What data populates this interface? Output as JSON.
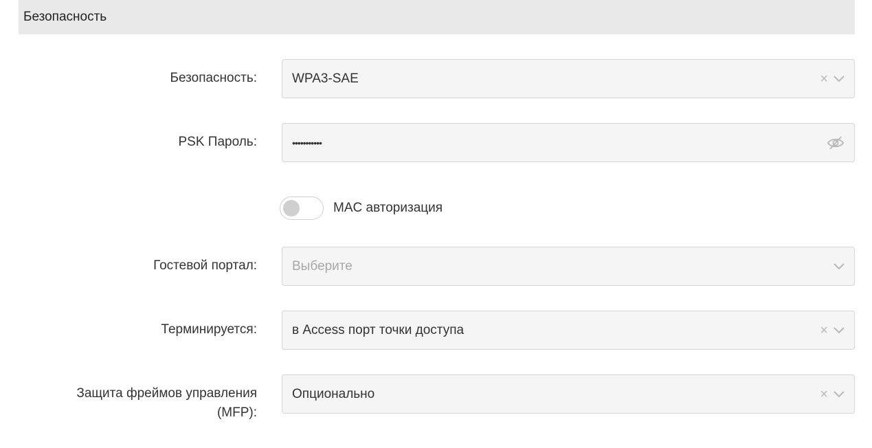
{
  "section": {
    "title": "Безопасность"
  },
  "fields": {
    "security": {
      "label": "Безопасность:",
      "value": "WPA3-SAE"
    },
    "psk_password": {
      "label": "PSK Пароль:",
      "value": "•••••••••••"
    },
    "mac_auth": {
      "label": "MAC авторизация",
      "enabled": false
    },
    "guest_portal": {
      "label": "Гостевой портал:",
      "placeholder": "Выберите"
    },
    "terminated": {
      "label": "Терминируется:",
      "value": "в Access порт точки доступа"
    },
    "mfp": {
      "label_line1": "Защита фреймов управления",
      "label_line2": "(MFP):",
      "value": "Опционально"
    }
  },
  "icons": {
    "clear": "clear-icon",
    "dropdown": "chevron-down-icon",
    "visibility": "eye-off-icon"
  },
  "colors": {
    "header_bg": "#e9e9e9",
    "field_bg": "#f5f5f5",
    "field_border": "#d6d6d6",
    "icon": "#b8b8b8",
    "placeholder": "#a8a8a8"
  }
}
